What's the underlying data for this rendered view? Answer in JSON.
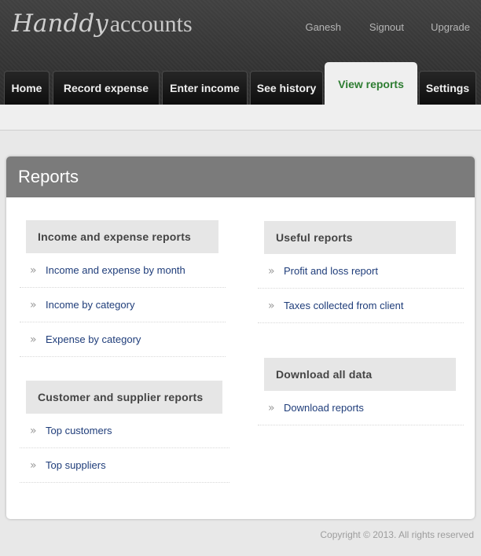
{
  "app": {
    "logo_brand": "Handdy",
    "logo_suffix": "accounts"
  },
  "top_nav": {
    "user": "Ganesh",
    "signout": "Signout",
    "upgrade": "Upgrade"
  },
  "tabs": [
    {
      "label": "Home"
    },
    {
      "label": "Record expense"
    },
    {
      "label": "Enter income"
    },
    {
      "label": "See history"
    },
    {
      "label": "View reports",
      "active": true
    },
    {
      "label": "Settings"
    }
  ],
  "panel": {
    "title": "Reports"
  },
  "sections": {
    "income_expense": {
      "title": "Income and expense reports",
      "items": [
        "Income and expense by month",
        "Income by category",
        "Expense by category"
      ]
    },
    "customer_supplier": {
      "title": "Customer and supplier reports",
      "items": [
        "Top customers",
        "Top suppliers"
      ]
    },
    "useful": {
      "title": "Useful reports",
      "items": [
        "Profit and loss report",
        "Taxes collected from client"
      ]
    },
    "download": {
      "title": "Download all data",
      "items": [
        "Download reports"
      ]
    }
  },
  "footer": {
    "copyright": "Copyright © 2013. All rights reserved"
  },
  "colors": {
    "active_tab_text": "#2e7d32",
    "link": "#1f3d7a",
    "panel_header": "#7b7b7b"
  }
}
